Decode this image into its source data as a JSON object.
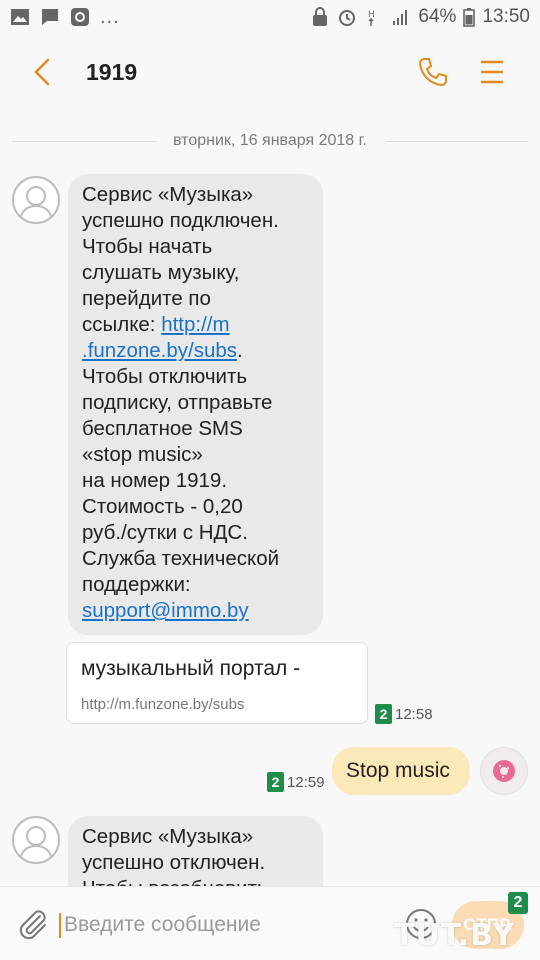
{
  "status_bar": {
    "icons_left": [
      "image-icon",
      "message-icon",
      "app-icon"
    ],
    "dots": "...",
    "icons_right": [
      "lock-icon",
      "alarm-icon",
      "network-icon",
      "signal-icon"
    ],
    "battery": "64%",
    "time": "13:50"
  },
  "app_bar": {
    "title": "1919"
  },
  "conversation": {
    "date": "вторник, 16 января 2018 г.",
    "message1": {
      "lines": [
        "Сервис «Музыка»",
        "успешно подключен.",
        "Чтобы начать",
        "слушать музыку,",
        "перейдите по",
        "ссылке: "
      ],
      "link_part1": "http://m",
      "link_part2": ".funzone.by/subs",
      "after_link": ".",
      "lines2": [
        "Чтобы отключить",
        "подписку, отправьте",
        "бесплатное SMS",
        "«stop music»",
        "на номер 1919.",
        "Стоимость - 0,20",
        "руб./сутки с НДС.",
        "Служба технической",
        "поддержки:"
      ],
      "email": "support@immo.by"
    },
    "preview": {
      "title": "музыкальный портал -",
      "url": "http://m.funzone.by/subs"
    },
    "meta1": {
      "sim": "2",
      "time": "12:58"
    },
    "outgoing": {
      "text": "Stop music",
      "sim": "2",
      "time": "12:59"
    },
    "message2": {
      "lines": [
        "Сервис «Музыка»",
        "успешно отключен.",
        "Чтобы возобновить"
      ]
    }
  },
  "compose": {
    "placeholder": "Введите сообщение",
    "send_label": "ОТПР.",
    "send_badge": "2"
  },
  "watermark": "TUT.BY",
  "colors": {
    "accent": "#e08b22",
    "incoming_bubble": "#e9e9e9",
    "outgoing_bubble": "#fce9b8",
    "link": "#1a73c8",
    "sim_badge": "#1f8c4a"
  }
}
